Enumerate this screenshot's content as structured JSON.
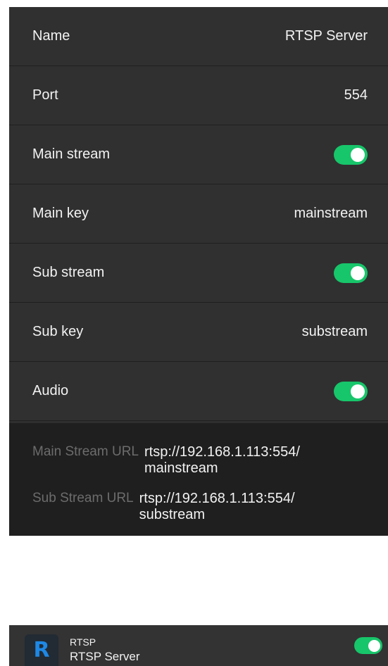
{
  "settings": {
    "rows": [
      {
        "label": "Name",
        "value": "RTSP Server"
      },
      {
        "label": "Port",
        "value": "554"
      },
      {
        "label": "Main stream",
        "toggle": true
      },
      {
        "label": "Main key",
        "value": "mainstream"
      },
      {
        "label": "Sub stream",
        "toggle": true
      },
      {
        "label": "Sub key",
        "value": "substream"
      },
      {
        "label": "Audio",
        "toggle": true
      }
    ],
    "main_url_label": "Main Stream URL",
    "main_url_value": "rtsp://192.168.1.113:554/ mainstream",
    "sub_url_label": "Sub Stream URL",
    "sub_url_value": "rtsp://192.168.1.113:554/ substream"
  },
  "app_card": {
    "icon_letter": "R",
    "name": "RTSP",
    "subtitle": "RTSP Server",
    "enabled": true
  },
  "colors": {
    "toggle_on": "#17c66a",
    "icon_blue": "#1e88e5",
    "panel_bg": "#303030"
  }
}
